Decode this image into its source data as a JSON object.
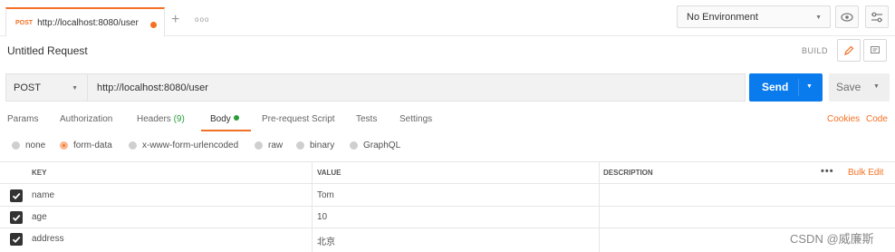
{
  "tab": {
    "method": "POST",
    "title": "http://localhost:8080/user"
  },
  "environment": {
    "selected": "No Environment"
  },
  "request": {
    "title": "Untitled Request",
    "build_label": "BUILD",
    "method": "POST",
    "url": "http://localhost:8080/user",
    "send_label": "Send",
    "save_label": "Save"
  },
  "request_tabs": {
    "params": "Params",
    "authorization": "Authorization",
    "headers": "Headers",
    "headers_count": "(9)",
    "body": "Body",
    "prerequest": "Pre-request Script",
    "tests": "Tests",
    "settings": "Settings",
    "cookies": "Cookies",
    "code": "Code"
  },
  "body_types": {
    "none": "none",
    "form_data": "form-data",
    "urlencoded": "x-www-form-urlencoded",
    "raw": "raw",
    "binary": "binary",
    "graphql": "GraphQL",
    "selected": "form-data"
  },
  "table": {
    "headers": {
      "key": "KEY",
      "value": "VALUE",
      "description": "DESCRIPTION",
      "bulk_edit": "Bulk Edit"
    },
    "rows": [
      {
        "key": "name",
        "value": "Tom",
        "checked": true
      },
      {
        "key": "age",
        "value": "10",
        "checked": true
      },
      {
        "key": "address",
        "value": "北京",
        "checked": true
      }
    ]
  },
  "watermark": "CSDN @威廉斯",
  "colors": {
    "accent": "#f47023",
    "send": "#097bed",
    "active_dot": "#2a9d3a"
  }
}
